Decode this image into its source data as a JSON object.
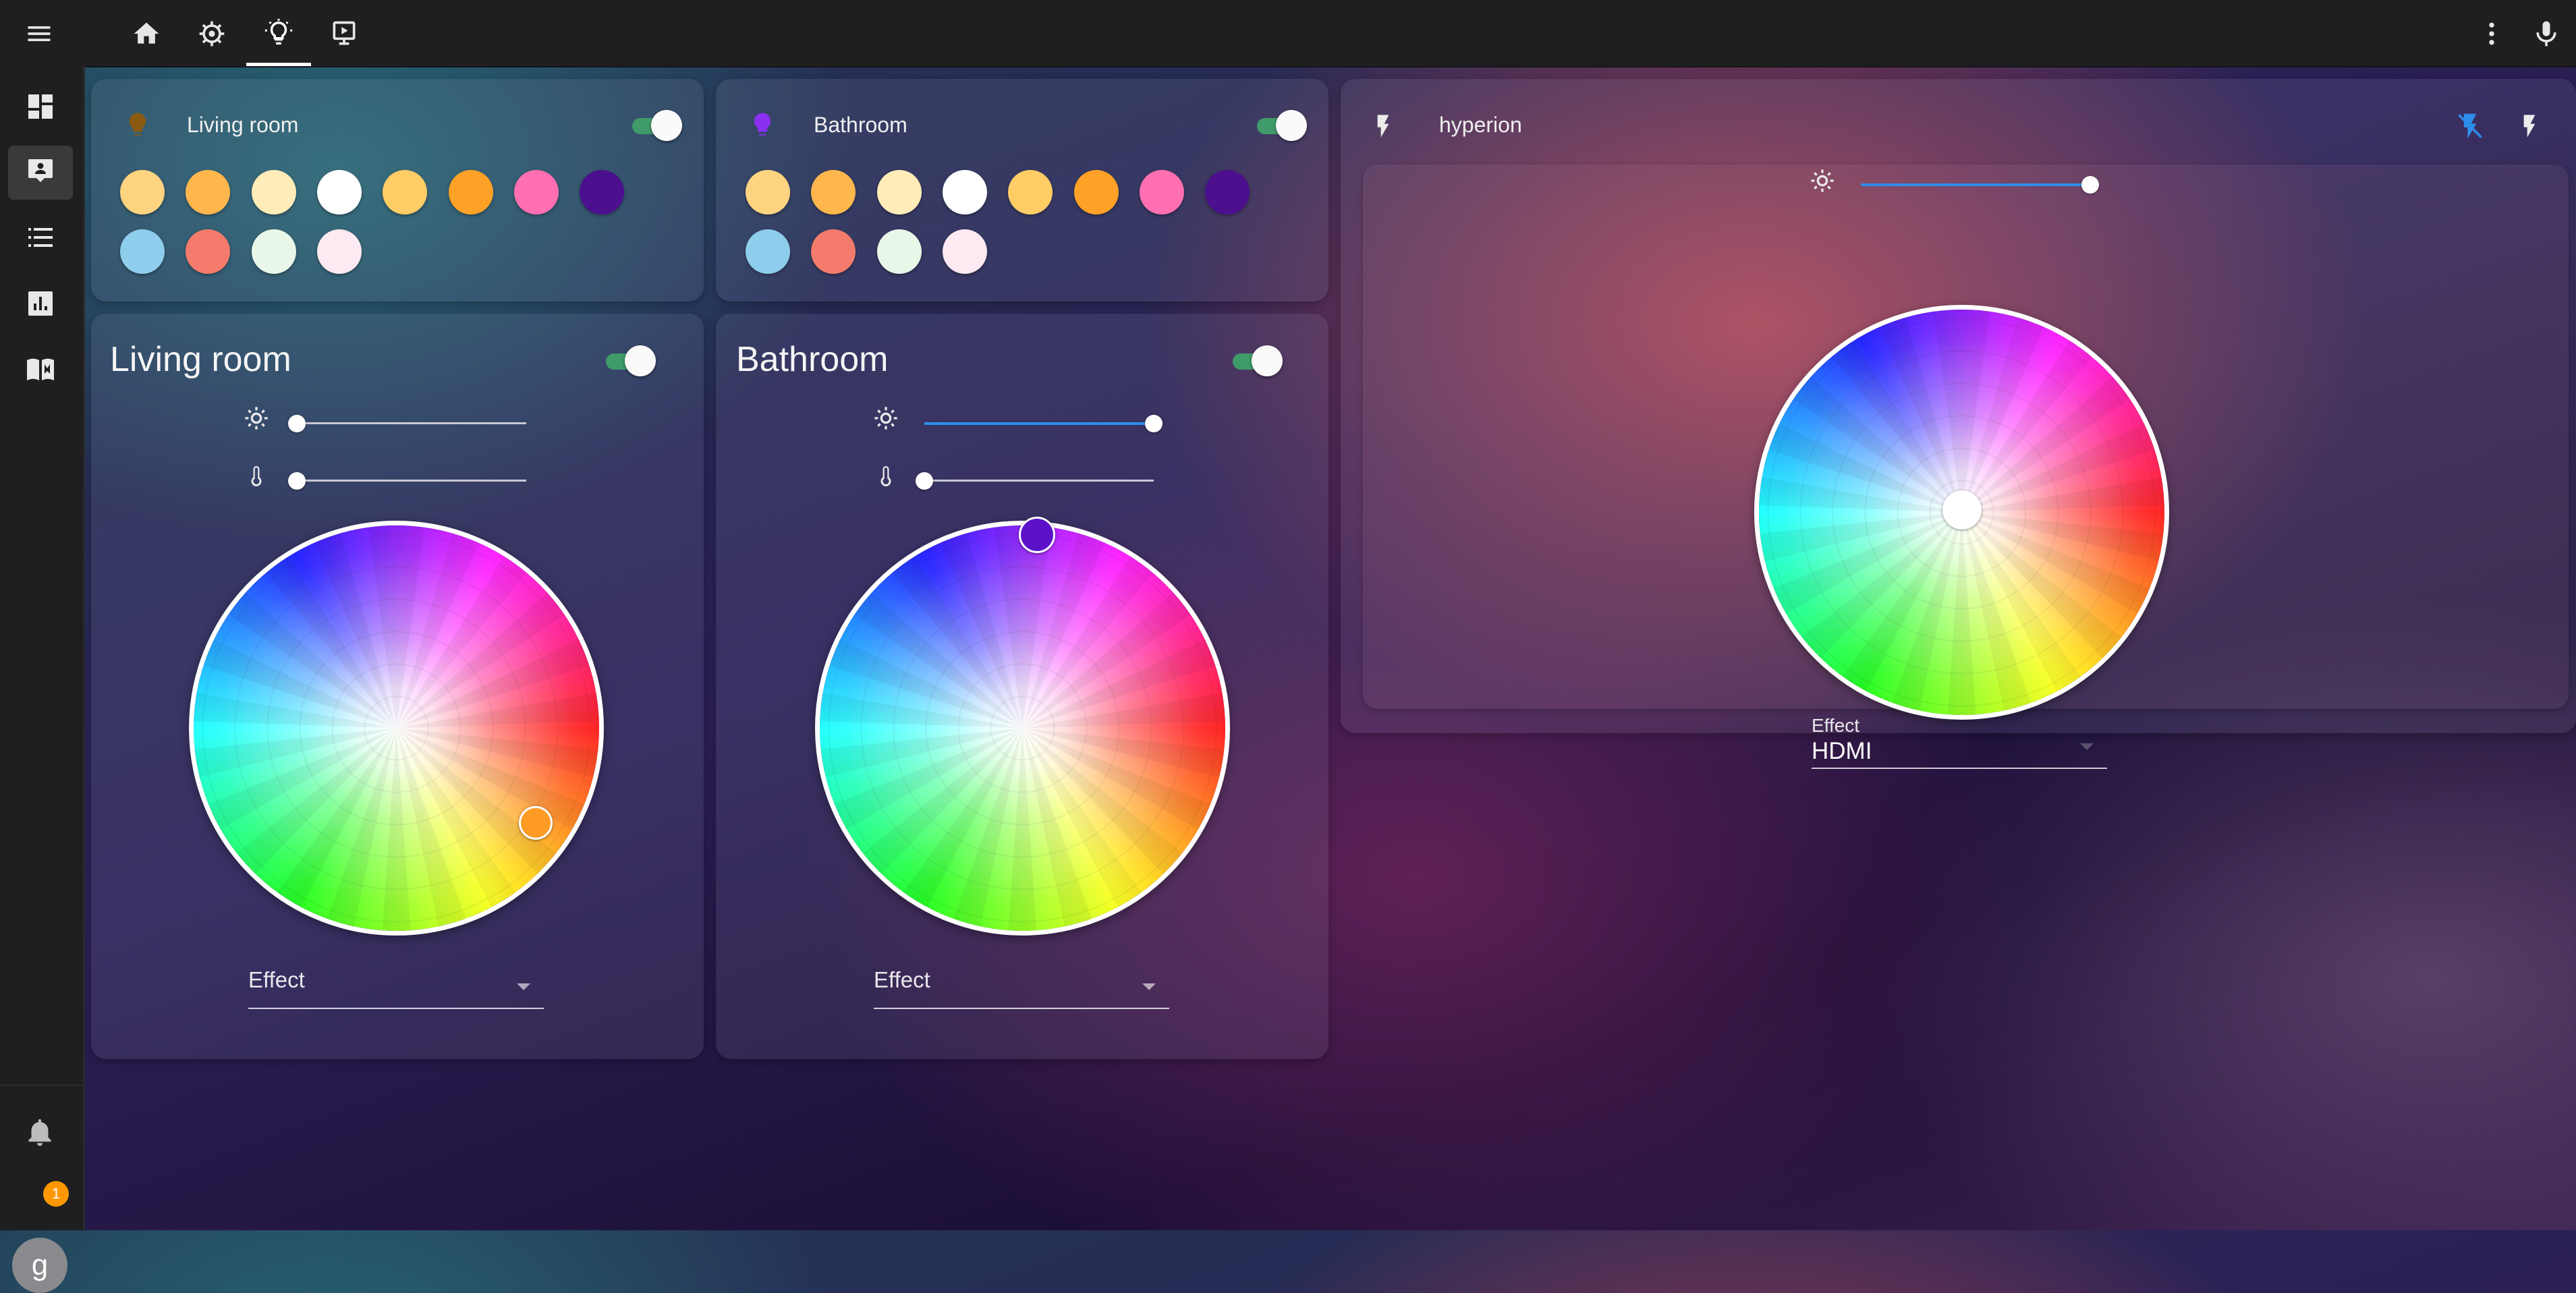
{
  "topbar": {
    "tabs": [
      {
        "icon": "home-icon"
      },
      {
        "icon": "devices-icon"
      },
      {
        "icon": "lightbulb-icon",
        "active": true
      },
      {
        "icon": "media-player-icon"
      }
    ]
  },
  "sidebar": {
    "items": [
      {
        "icon": "dashboard-icon",
        "active": true
      },
      {
        "icon": "dashboard-alt-icon"
      },
      {
        "icon": "list-icon"
      },
      {
        "icon": "chart-icon"
      },
      {
        "icon": "book-icon"
      }
    ],
    "notification_count": "1",
    "avatar_letter": "g"
  },
  "presets": [
    {
      "title": "Living room",
      "icon_color": "#8a5a12",
      "on": true,
      "swatches": [
        "#ffd480",
        "#ffb74d",
        "#ffecb8",
        "#ffffff",
        "#ffcc66",
        "#ffa126",
        "#ff6fb1",
        "#4c0f8e",
        "#8ecdec",
        "#f47b6b",
        "#e8f7e8",
        "#fde9f1"
      ]
    },
    {
      "title": "Bathroom",
      "icon_color": "#8b2ff0",
      "on": true,
      "swatches": [
        "#ffd480",
        "#ffb74d",
        "#ffecb8",
        "#ffffff",
        "#ffcc66",
        "#ffa126",
        "#ff6fb1",
        "#4c0f8e",
        "#8ecdec",
        "#f47b6b",
        "#e8f7e8",
        "#fde9f1"
      ]
    }
  ],
  "lights": [
    {
      "title": "Living room",
      "on": true,
      "brightness": 0,
      "color_temp": 0,
      "marker_color": "#ff9a22",
      "effect_label": "Effect",
      "effect_value": ""
    },
    {
      "title": "Bathroom",
      "on": true,
      "brightness": 100,
      "color_temp": 0,
      "marker_color": "#5b12c9",
      "effect_label": "Effect",
      "effect_value": ""
    }
  ],
  "hyperion": {
    "title": "hyperion",
    "brightness": 100,
    "effect_label": "Effect",
    "effect_value": "HDMI",
    "actions": [
      "flash-off-icon",
      "flash-icon"
    ]
  },
  "colors": {
    "accent": "#2d8dea",
    "toggle_track": "#3f9b6a",
    "badge": "#ff9800"
  }
}
